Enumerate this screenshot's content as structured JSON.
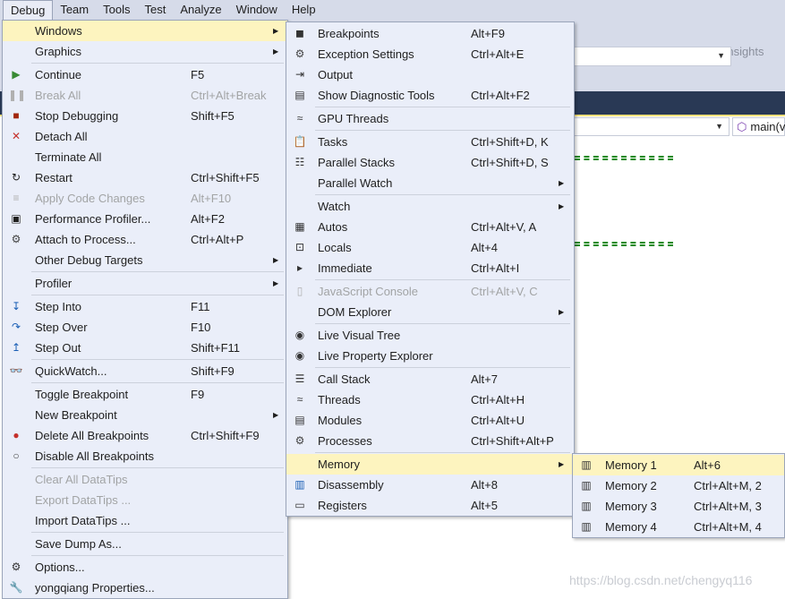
{
  "menubar": {
    "items": [
      {
        "label": "Debug",
        "active": true
      },
      {
        "label": "Team"
      },
      {
        "label": "Tools"
      },
      {
        "label": "Test"
      },
      {
        "label": "Analyze"
      },
      {
        "label": "Window"
      },
      {
        "label": "Help"
      }
    ]
  },
  "toolbar": {
    "insights_label": "No Application Insights",
    "function_combo": "main(v"
  },
  "watermark": "https://blog.csdn.net/chengyq116",
  "colors": {
    "highlight": "#fdf4bf",
    "menu_bg": "#eaeef9",
    "disabled": "#a2a4a5",
    "dark_band": "#293955"
  },
  "debug_menu": [
    {
      "label": "Windows",
      "submenu": true,
      "highlight": true
    },
    {
      "label": "Graphics",
      "submenu": true
    },
    {
      "sep": true
    },
    {
      "label": "Continue",
      "shortcut": "F5",
      "icon": "play-icon"
    },
    {
      "label": "Break All",
      "shortcut": "Ctrl+Alt+Break",
      "icon": "pause-icon",
      "disabled": true
    },
    {
      "label": "Stop Debugging",
      "shortcut": "Shift+F5",
      "icon": "stop-icon"
    },
    {
      "label": "Detach All",
      "icon": "x-icon"
    },
    {
      "label": "Terminate All"
    },
    {
      "label": "Restart",
      "shortcut": "Ctrl+Shift+F5",
      "icon": "restart-icon"
    },
    {
      "label": "Apply Code Changes",
      "shortcut": "Alt+F10",
      "icon": "apply-code-icon",
      "disabled": true
    },
    {
      "label": "Performance Profiler...",
      "shortcut": "Alt+F2",
      "icon": "profiler-icon"
    },
    {
      "label": "Attach to Process...",
      "shortcut": "Ctrl+Alt+P",
      "icon": "gears-icon"
    },
    {
      "label": "Other Debug Targets",
      "submenu": true
    },
    {
      "sep": true
    },
    {
      "label": "Profiler",
      "submenu": true
    },
    {
      "sep": true
    },
    {
      "label": "Step Into",
      "shortcut": "F11",
      "icon": "step-into-icon"
    },
    {
      "label": "Step Over",
      "shortcut": "F10",
      "icon": "step-over-icon"
    },
    {
      "label": "Step Out",
      "shortcut": "Shift+F11",
      "icon": "step-out-icon"
    },
    {
      "sep": true
    },
    {
      "label": "QuickWatch...",
      "shortcut": "Shift+F9",
      "icon": "glasses-icon"
    },
    {
      "sep": true
    },
    {
      "label": "Toggle Breakpoint",
      "shortcut": "F9"
    },
    {
      "label": "New Breakpoint",
      "submenu": true
    },
    {
      "label": "Delete All Breakpoints",
      "shortcut": "Ctrl+Shift+F9",
      "icon": "delete-breakpoints-icon"
    },
    {
      "label": "Disable All Breakpoints",
      "icon": "disable-breakpoints-icon"
    },
    {
      "sep": true
    },
    {
      "label": "Clear All DataTips",
      "disabled": true
    },
    {
      "label": "Export DataTips ...",
      "disabled": true
    },
    {
      "label": "Import DataTips ..."
    },
    {
      "sep": true
    },
    {
      "label": "Save Dump As..."
    },
    {
      "sep": true
    },
    {
      "label": "Options...",
      "icon": "gear-icon"
    },
    {
      "label": "yongqiang Properties...",
      "icon": "wrench-icon"
    }
  ],
  "windows_menu": [
    {
      "label": "Breakpoints",
      "shortcut": "Alt+F9",
      "icon": "breakpoints-icon"
    },
    {
      "label": "Exception Settings",
      "shortcut": "Ctrl+Alt+E",
      "icon": "exception-icon"
    },
    {
      "label": "Output",
      "icon": "output-icon"
    },
    {
      "label": "Show Diagnostic Tools",
      "shortcut": "Ctrl+Alt+F2",
      "icon": "diagnostic-icon"
    },
    {
      "sep": true
    },
    {
      "label": "GPU Threads",
      "icon": "threads-icon"
    },
    {
      "sep": true
    },
    {
      "label": "Tasks",
      "shortcut": "Ctrl+Shift+D, K",
      "icon": "clipboard-icon"
    },
    {
      "label": "Parallel Stacks",
      "shortcut": "Ctrl+Shift+D, S",
      "icon": "stacks-icon"
    },
    {
      "label": "Parallel Watch",
      "submenu": true
    },
    {
      "sep": true
    },
    {
      "label": "Watch",
      "submenu": true
    },
    {
      "label": "Autos",
      "shortcut": "Ctrl+Alt+V, A",
      "icon": "autos-icon"
    },
    {
      "label": "Locals",
      "shortcut": "Alt+4",
      "icon": "locals-icon"
    },
    {
      "label": "Immediate",
      "shortcut": "Ctrl+Alt+I",
      "icon": "immediate-icon"
    },
    {
      "sep": true
    },
    {
      "label": "JavaScript Console",
      "shortcut": "Ctrl+Alt+V, C",
      "icon": "console-icon",
      "disabled": true
    },
    {
      "label": "DOM Explorer",
      "submenu": true
    },
    {
      "sep": true
    },
    {
      "label": "Live Visual Tree",
      "icon": "camera-icon"
    },
    {
      "label": "Live Property Explorer",
      "icon": "camera-icon"
    },
    {
      "sep": true
    },
    {
      "label": "Call Stack",
      "shortcut": "Alt+7",
      "icon": "callstack-icon"
    },
    {
      "label": "Threads",
      "shortcut": "Ctrl+Alt+H",
      "icon": "threads-icon"
    },
    {
      "label": "Modules",
      "shortcut": "Ctrl+Alt+U",
      "icon": "modules-icon"
    },
    {
      "label": "Processes",
      "shortcut": "Ctrl+Shift+Alt+P",
      "icon": "gears-icon"
    },
    {
      "sep": true
    },
    {
      "label": "Memory",
      "submenu": true,
      "highlight": true
    },
    {
      "label": "Disassembly",
      "shortcut": "Alt+8",
      "icon": "disassembly-icon"
    },
    {
      "label": "Registers",
      "shortcut": "Alt+5",
      "icon": "registers-icon"
    }
  ],
  "memory_menu": [
    {
      "label": "Memory 1",
      "shortcut": "Alt+6",
      "icon": "memory-chip-icon",
      "highlight": true
    },
    {
      "label": "Memory 2",
      "shortcut": "Ctrl+Alt+M, 2",
      "icon": "memory-chip-icon"
    },
    {
      "label": "Memory 3",
      "shortcut": "Ctrl+Alt+M, 3",
      "icon": "memory-chip-icon"
    },
    {
      "label": "Memory 4",
      "shortcut": "Ctrl+Alt+M, 4",
      "icon": "memory-chip-icon"
    }
  ]
}
